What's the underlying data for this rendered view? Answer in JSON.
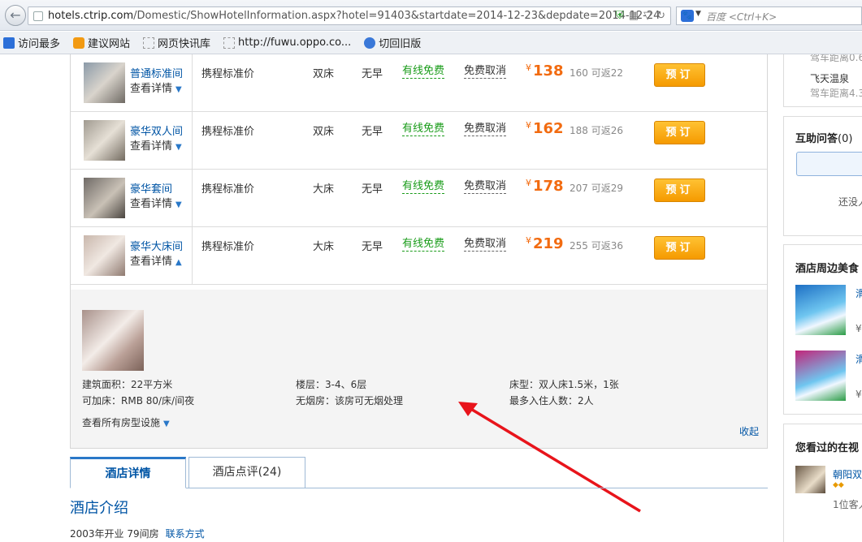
{
  "browser": {
    "url_host": "hotels.ctrip.com",
    "url_path": "/Domestic/ShowHotelInformation.aspx?hotel=91403&startdate=2014-12-23&depdate=2014-12-24",
    "search_placeholder": "百度 <Ctrl+K>",
    "bookmarks": [
      "访问最多",
      "建议网站",
      "网页快讯库",
      "http://fuwu.oppo.co...",
      "切回旧版"
    ]
  },
  "rooms": [
    {
      "name": "普通标准间",
      "detail": "查看详情",
      "policy": "携程标准价",
      "bed": "双床",
      "breakfast": "无早",
      "network": "有线免费",
      "cancel": "免费取消",
      "currency": "¥",
      "price": "138",
      "original": "160 可返22",
      "book": "预订"
    },
    {
      "name": "豪华双人间",
      "detail": "查看详情",
      "policy": "携程标准价",
      "bed": "双床",
      "breakfast": "无早",
      "network": "有线免费",
      "cancel": "免费取消",
      "currency": "¥",
      "price": "162",
      "original": "188 可返26",
      "book": "预订"
    },
    {
      "name": "豪华套间",
      "detail": "查看详情",
      "policy": "携程标准价",
      "bed": "大床",
      "breakfast": "无早",
      "network": "有线免费",
      "cancel": "免费取消",
      "currency": "¥",
      "price": "178",
      "original": "207 可返29",
      "book": "预订"
    },
    {
      "name": "豪华大床间",
      "detail": "查看详情",
      "policy": "携程标准价",
      "bed": "大床",
      "breakfast": "无早",
      "network": "有线免费",
      "cancel": "免费取消",
      "currency": "¥",
      "price": "219",
      "original": "255 可返36",
      "book": "预订"
    }
  ],
  "room_info": {
    "area": "建筑面积：22平方米",
    "floor": "楼层：3-4、6层",
    "bed_type": "床型：双人床1.5米，1张",
    "extra_bed": "可加床：RMB 80/床/间夜",
    "non_smoking": "无烟房：该房可无烟处理",
    "max_guests": "最多入住人数：2人",
    "all_facilities": "查看所有房型设施",
    "collapse": "收起"
  },
  "tabs": {
    "details": "酒店详情",
    "reviews": "酒店点评(24)"
  },
  "intro": {
    "title": "酒店介绍",
    "text": "2003年开业  79间房",
    "contact": "联系方式"
  },
  "sidebar": {
    "top_distance_1": "驾车距离0.6",
    "place": "飞天温泉",
    "place_distance": "驾车距离4.3",
    "qa_title": "互助问答",
    "qa_count": "(0)",
    "qa_empty": "还没人",
    "food_title": "酒店周边美食",
    "food_price_1": "¥",
    "food_price_2": "¥",
    "food_name_1": "滑",
    "food_name_2": "滑",
    "viewed_title": "您看过的在视",
    "viewed_name": "朝阳双",
    "viewed_guests": "1位客人"
  }
}
